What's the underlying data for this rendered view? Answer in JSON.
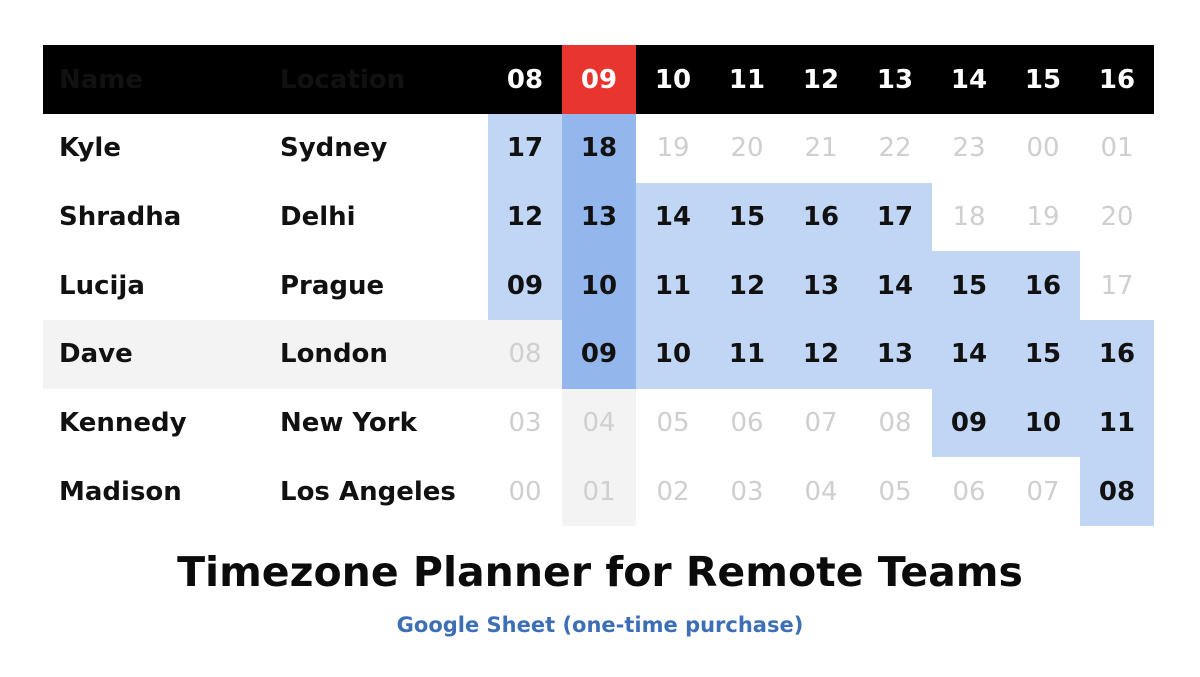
{
  "table": {
    "headers": {
      "name": "Name",
      "location": "Location",
      "hours": [
        "08",
        "09",
        "10",
        "11",
        "12",
        "13",
        "14",
        "15",
        "16"
      ]
    },
    "highlighted_column_index": 1,
    "rows": [
      {
        "name": "Kyle",
        "location": "Sydney",
        "hours": [
          "17",
          "18",
          "19",
          "20",
          "21",
          "22",
          "23",
          "00",
          "01"
        ],
        "working": [
          true,
          true,
          false,
          false,
          false,
          false,
          false,
          false,
          false
        ]
      },
      {
        "name": "Shradha",
        "location": "Delhi",
        "hours": [
          "12",
          "13",
          "14",
          "15",
          "16",
          "17",
          "18",
          "19",
          "20"
        ],
        "working": [
          true,
          true,
          true,
          true,
          true,
          true,
          false,
          false,
          false
        ]
      },
      {
        "name": "Lucija",
        "location": "Prague",
        "hours": [
          "09",
          "10",
          "11",
          "12",
          "13",
          "14",
          "15",
          "16",
          "17"
        ],
        "working": [
          true,
          true,
          true,
          true,
          true,
          true,
          true,
          true,
          false
        ]
      },
      {
        "name": "Dave",
        "location": "London",
        "hours": [
          "08",
          "09",
          "10",
          "11",
          "12",
          "13",
          "14",
          "15",
          "16"
        ],
        "working": [
          false,
          true,
          true,
          true,
          true,
          true,
          true,
          true,
          true
        ],
        "highlighted_row": true
      },
      {
        "name": "Kennedy",
        "location": "New York",
        "hours": [
          "03",
          "04",
          "05",
          "06",
          "07",
          "08",
          "09",
          "10",
          "11"
        ],
        "working": [
          false,
          false,
          false,
          false,
          false,
          false,
          true,
          true,
          true
        ]
      },
      {
        "name": "Madison",
        "location": "Los Angeles",
        "hours": [
          "00",
          "01",
          "02",
          "03",
          "04",
          "05",
          "06",
          "07",
          "08"
        ],
        "working": [
          false,
          false,
          false,
          false,
          false,
          false,
          false,
          false,
          true
        ]
      }
    ]
  },
  "title": "Timezone Planner for Remote Teams",
  "subtitle": "Google Sheet (one-time purchase)",
  "colors": {
    "header_background": "#000000",
    "header_text": "#ffffff",
    "current_hour_header": "#e8352f",
    "working_hours": "#c1d5f4",
    "current_hour_working": "#93b7ec",
    "highlighted_row": "#f3f3f3",
    "off_hours_text": "#cfcfcf",
    "subtitle_text": "#3d6fb6"
  }
}
